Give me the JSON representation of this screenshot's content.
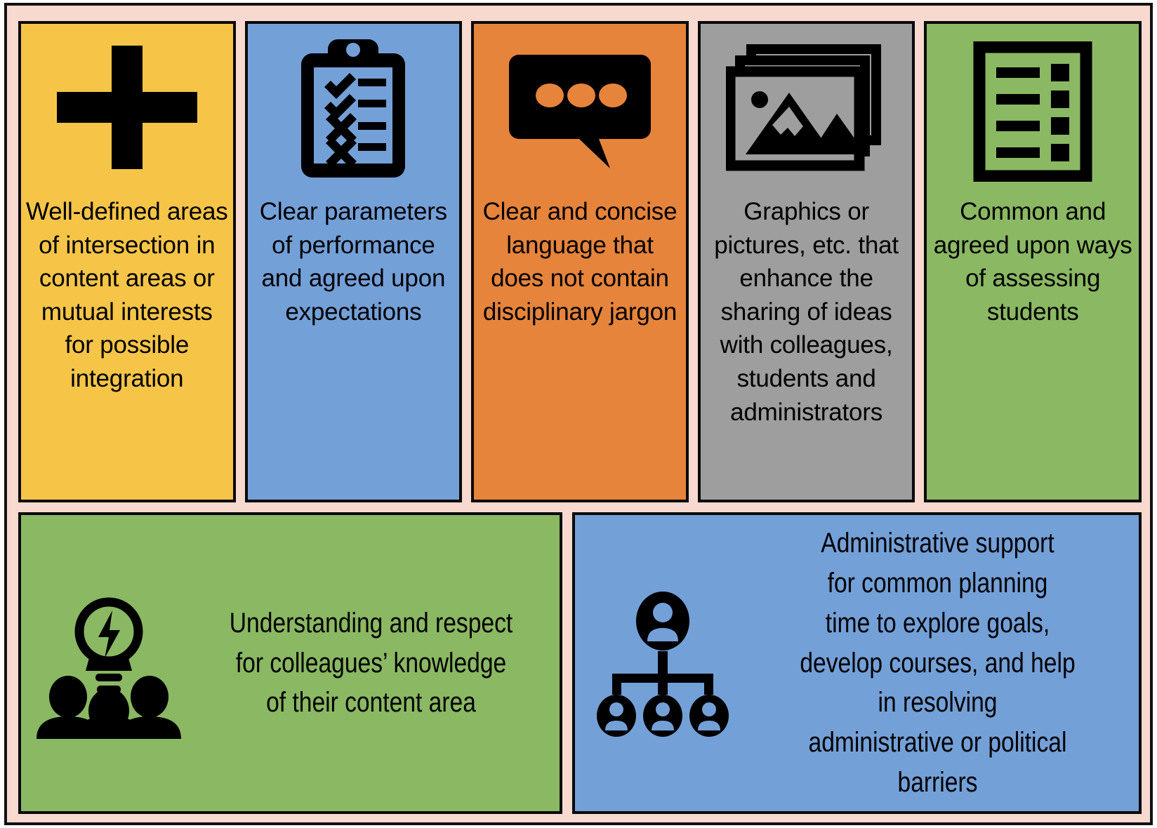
{
  "frame": {
    "background_color": "#f7d9d0",
    "border_color": "#111111"
  },
  "top_row": [
    {
      "id": "well-defined-areas",
      "color": "#f6c548",
      "icon": "plus-icon",
      "text": "Well-defined areas of intersection in content areas or mutual interests for possible integration"
    },
    {
      "id": "clear-parameters",
      "color": "#74a0d8",
      "icon": "clipboard-checklist-icon",
      "text": "Clear parameters of performance and agreed upon expectations"
    },
    {
      "id": "clear-concise-language",
      "color": "#e6843c",
      "icon": "speech-bubble-icon",
      "text": "Clear and concise language that does not contain disciplinary jargon"
    },
    {
      "id": "graphics-pictures",
      "color": "#9e9e9e",
      "icon": "image-stack-icon",
      "text": "Graphics or pictures, etc. that enhance the sharing of ideas with colleagues, students and administrators"
    },
    {
      "id": "common-assessing",
      "color": "#8bb863",
      "icon": "list-document-icon",
      "text": "Common and agreed upon ways of assessing students"
    }
  ],
  "bottom_row": [
    {
      "id": "understanding-respect",
      "color": "#8bb863",
      "icon": "lightbulb-people-icon",
      "text": "Understanding and respect\nfor colleagues’ knowledge\nof their content area"
    },
    {
      "id": "administrative-support",
      "color": "#74a0d8",
      "icon": "org-chart-icon",
      "text": "Administrative support\nfor common planning\ntime to explore goals,\ndevelop courses, and help\nin resolving\nadministrative or political\nbarriers"
    }
  ]
}
